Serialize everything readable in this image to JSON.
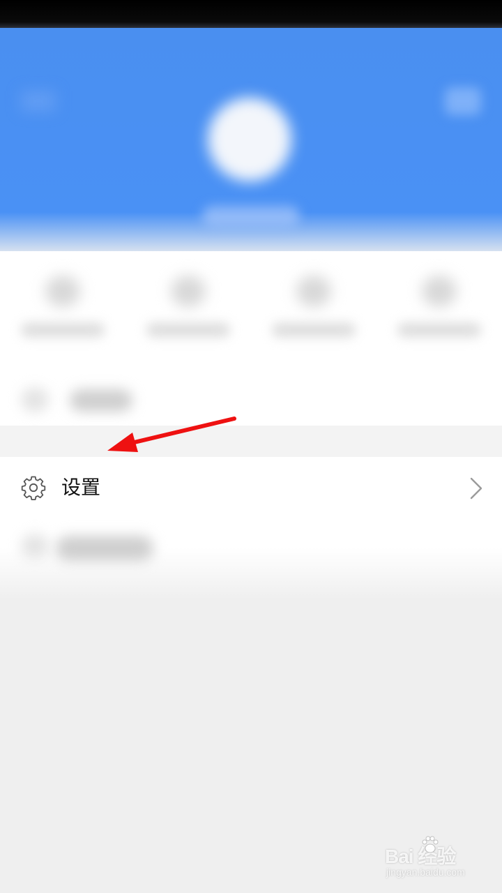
{
  "settings_row": {
    "label": "设置",
    "icon": "gear-icon",
    "trailing_icon": "chevron-right-icon"
  },
  "annotation": {
    "type": "red-arrow",
    "color": "#ee1111",
    "points_to": "settings_row"
  },
  "header": {
    "background_color": "#4a8ff0",
    "blurred": true
  },
  "watermark": {
    "brand": "Bai  经验",
    "domain": "jingyan.baidu.com"
  }
}
